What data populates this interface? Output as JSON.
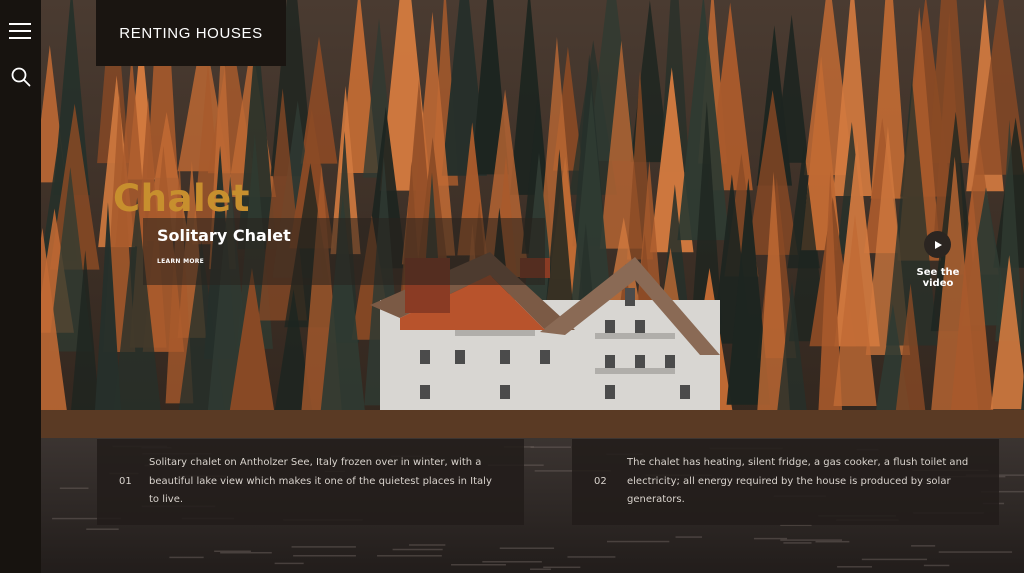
{
  "brand": {
    "title": "RENTING HOUSES"
  },
  "nav": {
    "menu_icon": "hamburger-menu-icon",
    "search_icon": "search-icon"
  },
  "hero": {
    "kicker": "Chalet",
    "title": "Solitary Chalet",
    "cta": "LEARN MORE"
  },
  "video": {
    "icon": "play-icon",
    "label": "See the video"
  },
  "cards": [
    {
      "number": "01",
      "text": "Solitary chalet on Antholzer See, Italy frozen over in winter, with a beautiful lake view which makes it one of the quietest places in Italy to live."
    },
    {
      "number": "02",
      "text": "The chalet has heating, silent fridge, a gas cooker, a flush toilet and electricity; all energy required by the house is produced by solar generators."
    }
  ],
  "colors": {
    "accent": "#c78f2e",
    "rail": "#17130f",
    "panel": "#1a1511"
  }
}
